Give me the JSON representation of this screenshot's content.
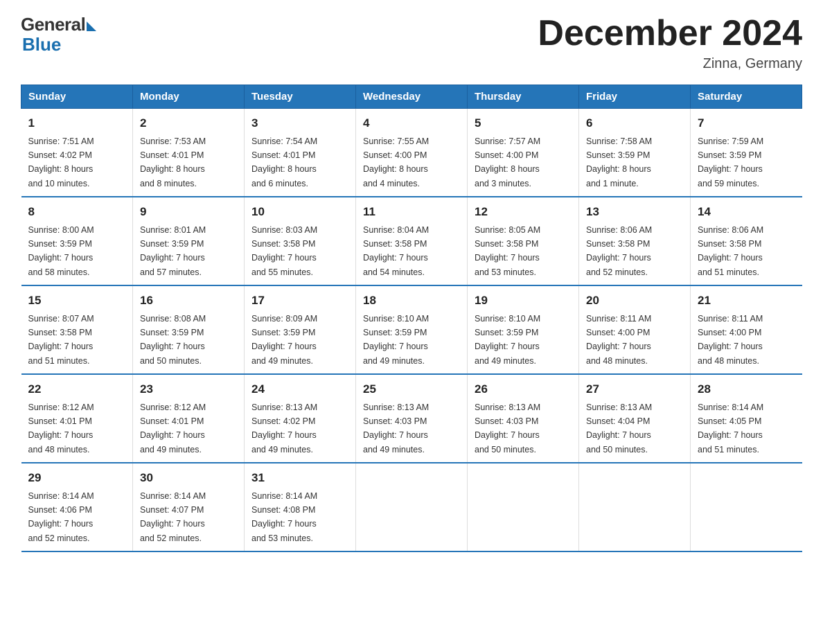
{
  "logo": {
    "general": "General",
    "blue": "Blue"
  },
  "title": {
    "month_year": "December 2024",
    "location": "Zinna, Germany"
  },
  "weekdays": [
    "Sunday",
    "Monday",
    "Tuesday",
    "Wednesday",
    "Thursday",
    "Friday",
    "Saturday"
  ],
  "weeks": [
    [
      {
        "day": "1",
        "sunrise": "7:51 AM",
        "sunset": "4:02 PM",
        "daylight": "8 hours and 10 minutes."
      },
      {
        "day": "2",
        "sunrise": "7:53 AM",
        "sunset": "4:01 PM",
        "daylight": "8 hours and 8 minutes."
      },
      {
        "day": "3",
        "sunrise": "7:54 AM",
        "sunset": "4:01 PM",
        "daylight": "8 hours and 6 minutes."
      },
      {
        "day": "4",
        "sunrise": "7:55 AM",
        "sunset": "4:00 PM",
        "daylight": "8 hours and 4 minutes."
      },
      {
        "day": "5",
        "sunrise": "7:57 AM",
        "sunset": "4:00 PM",
        "daylight": "8 hours and 3 minutes."
      },
      {
        "day": "6",
        "sunrise": "7:58 AM",
        "sunset": "3:59 PM",
        "daylight": "8 hours and 1 minute."
      },
      {
        "day": "7",
        "sunrise": "7:59 AM",
        "sunset": "3:59 PM",
        "daylight": "7 hours and 59 minutes."
      }
    ],
    [
      {
        "day": "8",
        "sunrise": "8:00 AM",
        "sunset": "3:59 PM",
        "daylight": "7 hours and 58 minutes."
      },
      {
        "day": "9",
        "sunrise": "8:01 AM",
        "sunset": "3:59 PM",
        "daylight": "7 hours and 57 minutes."
      },
      {
        "day": "10",
        "sunrise": "8:03 AM",
        "sunset": "3:58 PM",
        "daylight": "7 hours and 55 minutes."
      },
      {
        "day": "11",
        "sunrise": "8:04 AM",
        "sunset": "3:58 PM",
        "daylight": "7 hours and 54 minutes."
      },
      {
        "day": "12",
        "sunrise": "8:05 AM",
        "sunset": "3:58 PM",
        "daylight": "7 hours and 53 minutes."
      },
      {
        "day": "13",
        "sunrise": "8:06 AM",
        "sunset": "3:58 PM",
        "daylight": "7 hours and 52 minutes."
      },
      {
        "day": "14",
        "sunrise": "8:06 AM",
        "sunset": "3:58 PM",
        "daylight": "7 hours and 51 minutes."
      }
    ],
    [
      {
        "day": "15",
        "sunrise": "8:07 AM",
        "sunset": "3:58 PM",
        "daylight": "7 hours and 51 minutes."
      },
      {
        "day": "16",
        "sunrise": "8:08 AM",
        "sunset": "3:59 PM",
        "daylight": "7 hours and 50 minutes."
      },
      {
        "day": "17",
        "sunrise": "8:09 AM",
        "sunset": "3:59 PM",
        "daylight": "7 hours and 49 minutes."
      },
      {
        "day": "18",
        "sunrise": "8:10 AM",
        "sunset": "3:59 PM",
        "daylight": "7 hours and 49 minutes."
      },
      {
        "day": "19",
        "sunrise": "8:10 AM",
        "sunset": "3:59 PM",
        "daylight": "7 hours and 49 minutes."
      },
      {
        "day": "20",
        "sunrise": "8:11 AM",
        "sunset": "4:00 PM",
        "daylight": "7 hours and 48 minutes."
      },
      {
        "day": "21",
        "sunrise": "8:11 AM",
        "sunset": "4:00 PM",
        "daylight": "7 hours and 48 minutes."
      }
    ],
    [
      {
        "day": "22",
        "sunrise": "8:12 AM",
        "sunset": "4:01 PM",
        "daylight": "7 hours and 48 minutes."
      },
      {
        "day": "23",
        "sunrise": "8:12 AM",
        "sunset": "4:01 PM",
        "daylight": "7 hours and 49 minutes."
      },
      {
        "day": "24",
        "sunrise": "8:13 AM",
        "sunset": "4:02 PM",
        "daylight": "7 hours and 49 minutes."
      },
      {
        "day": "25",
        "sunrise": "8:13 AM",
        "sunset": "4:03 PM",
        "daylight": "7 hours and 49 minutes."
      },
      {
        "day": "26",
        "sunrise": "8:13 AM",
        "sunset": "4:03 PM",
        "daylight": "7 hours and 50 minutes."
      },
      {
        "day": "27",
        "sunrise": "8:13 AM",
        "sunset": "4:04 PM",
        "daylight": "7 hours and 50 minutes."
      },
      {
        "day": "28",
        "sunrise": "8:14 AM",
        "sunset": "4:05 PM",
        "daylight": "7 hours and 51 minutes."
      }
    ],
    [
      {
        "day": "29",
        "sunrise": "8:14 AM",
        "sunset": "4:06 PM",
        "daylight": "7 hours and 52 minutes."
      },
      {
        "day": "30",
        "sunrise": "8:14 AM",
        "sunset": "4:07 PM",
        "daylight": "7 hours and 52 minutes."
      },
      {
        "day": "31",
        "sunrise": "8:14 AM",
        "sunset": "4:08 PM",
        "daylight": "7 hours and 53 minutes."
      },
      null,
      null,
      null,
      null
    ]
  ],
  "labels": {
    "sunrise": "Sunrise:",
    "sunset": "Sunset:",
    "daylight": "Daylight:"
  }
}
